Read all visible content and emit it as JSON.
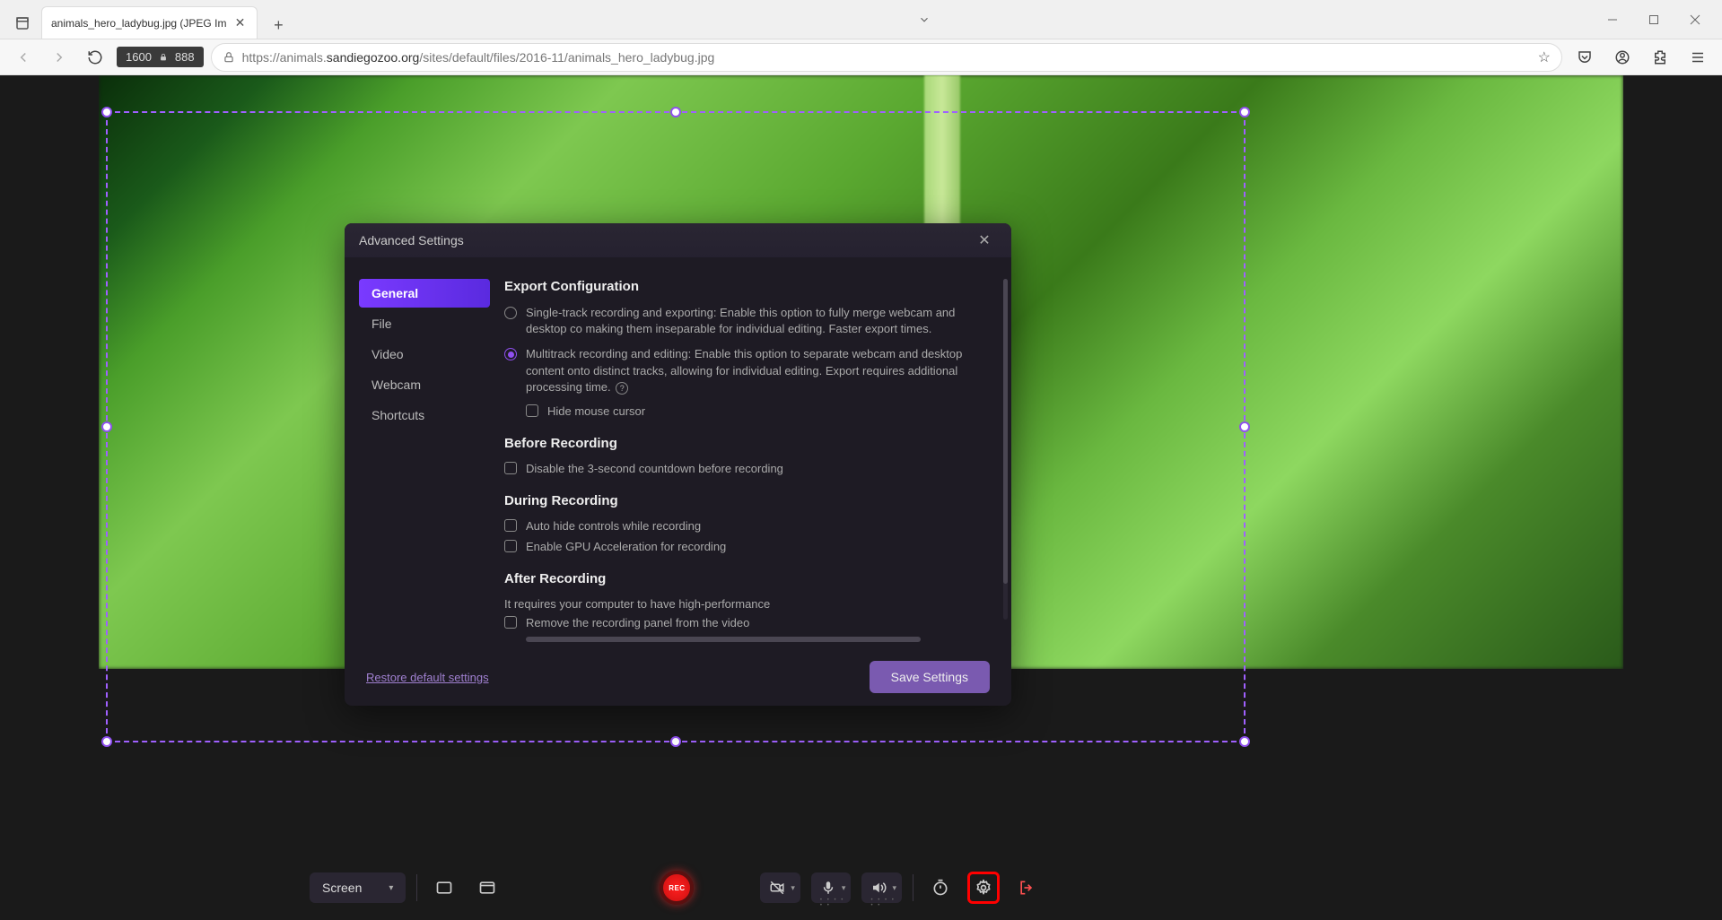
{
  "browser": {
    "tab_title": "animals_hero_ladybug.jpg (JPEG Im",
    "url_prefix": "https://animals.",
    "url_domain": "sandiegozoo.org",
    "url_path": "/sites/default/files/2016-11/animals_hero_ladybug.jpg"
  },
  "selection": {
    "width": "1600",
    "height": "888"
  },
  "modal": {
    "title": "Advanced Settings",
    "sidebar": {
      "general": "General",
      "file": "File",
      "video": "Video",
      "webcam": "Webcam",
      "shortcuts": "Shortcuts"
    },
    "sections": {
      "export": {
        "heading": "Export Configuration",
        "opt_single": "Single-track recording and exporting: Enable this option to fully merge webcam and desktop co making them inseparable for individual editing. Faster export times.",
        "opt_multi": "Multitrack recording and editing: Enable this option to separate webcam and desktop content onto distinct tracks, allowing for individual editing. Export requires additional processing time.",
        "hide_cursor": "Hide mouse cursor"
      },
      "before": {
        "heading": "Before Recording",
        "disable_countdown": "Disable the 3-second countdown before recording"
      },
      "during": {
        "heading": "During Recording",
        "auto_hide": "Auto hide controls while recording",
        "gpu": "Enable GPU Acceleration for recording"
      },
      "after": {
        "heading": "After Recording",
        "note": "It requires your computer to have high-performance",
        "remove_panel": "Remove the recording panel from the video"
      }
    },
    "footer": {
      "restore": "Restore default settings",
      "save": "Save Settings"
    }
  },
  "toolbar": {
    "screen": "Screen",
    "rec": "REC"
  }
}
